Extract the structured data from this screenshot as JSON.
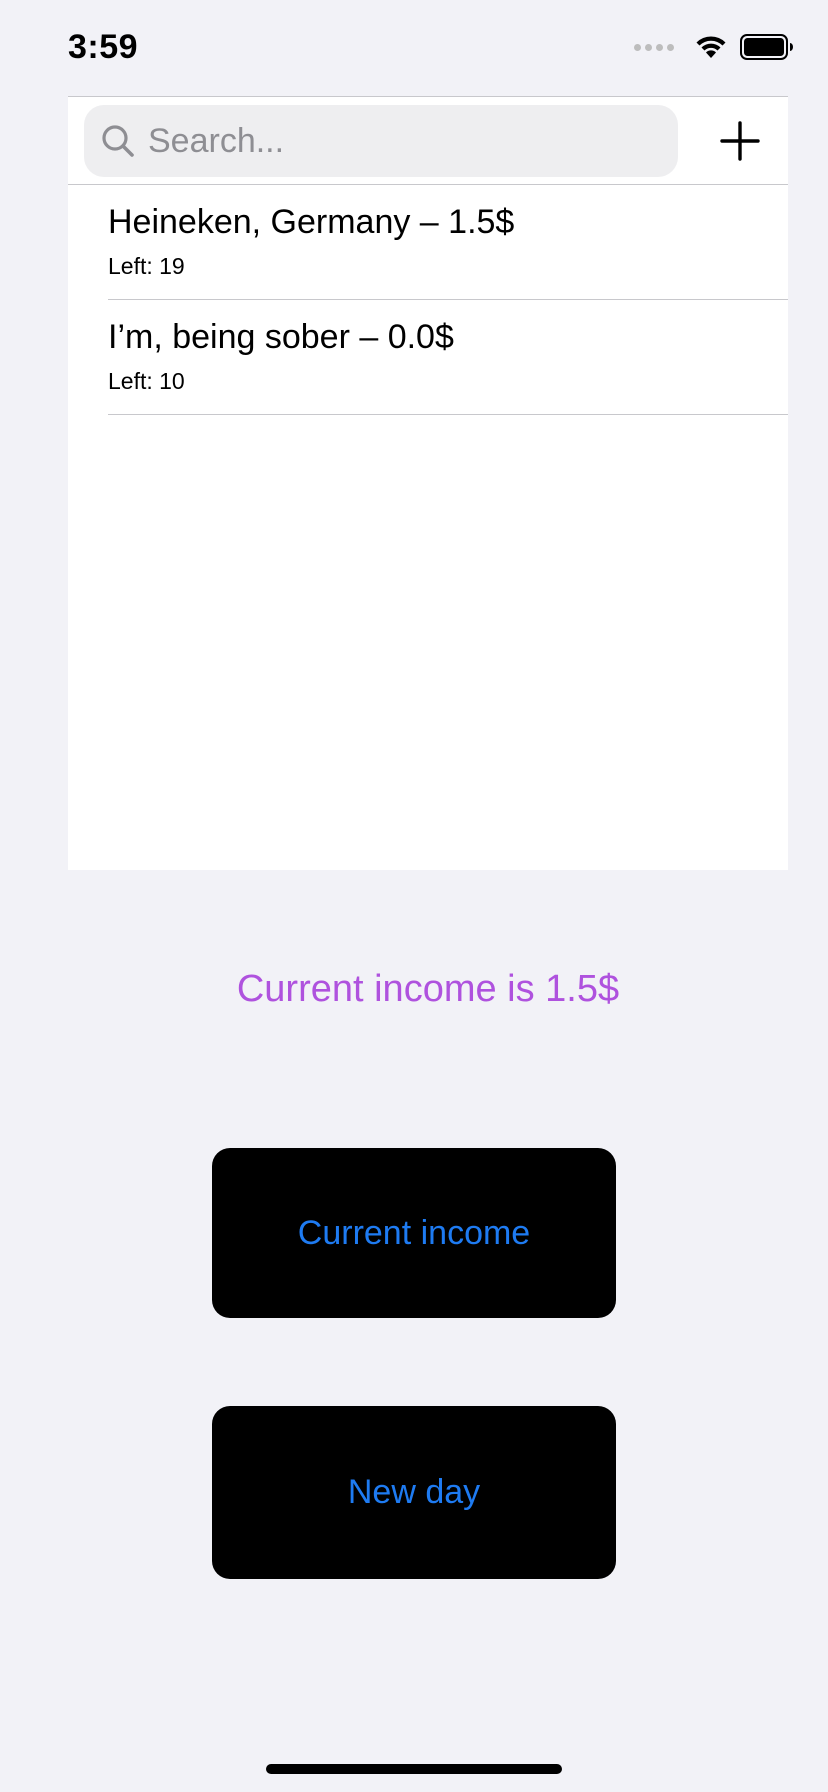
{
  "status_bar": {
    "time": "3:59"
  },
  "search": {
    "placeholder": "Search...",
    "value": ""
  },
  "list": {
    "items": [
      {
        "title": "Heineken, Germany – 1.5$",
        "subtitle": "Left: 19"
      },
      {
        "title": "I’m, being sober – 0.0$",
        "subtitle": "Left: 10"
      }
    ]
  },
  "income": {
    "text": "Current income is 1.5$"
  },
  "buttons": {
    "current_income": "Current income",
    "new_day": "New day"
  },
  "icons": {
    "search": "search-icon",
    "add": "plus-icon",
    "wifi": "wifi-icon",
    "battery": "battery-icon",
    "signal": "signal-icon"
  },
  "colors": {
    "background": "#F2F2F7",
    "income_text": "#AF52DE",
    "button_text": "#1E7BF2",
    "button_bg": "#000000"
  }
}
